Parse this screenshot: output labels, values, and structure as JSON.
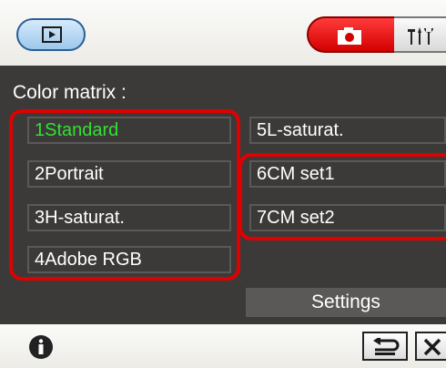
{
  "panel": {
    "title": "Color matrix :"
  },
  "options": [
    {
      "label": "1Standard",
      "selected": true
    },
    {
      "label": "2Portrait"
    },
    {
      "label": "3H-saturat."
    },
    {
      "label": "4Adobe RGB"
    },
    {
      "label": "5L-saturat."
    },
    {
      "label": "6CM set1"
    },
    {
      "label": "7CM set2"
    }
  ],
  "settings_label": "Settings",
  "icons": {
    "play": "play-mode-icon",
    "camera": "camera-icon",
    "setup": "setup-icon",
    "info": "info-icon",
    "back": "return-icon",
    "close": "close-icon"
  },
  "colors": {
    "selected_text": "#33e033",
    "highlight": "#e00000",
    "camera_tab": "#e00000",
    "play_button": "#9dc7ec"
  }
}
